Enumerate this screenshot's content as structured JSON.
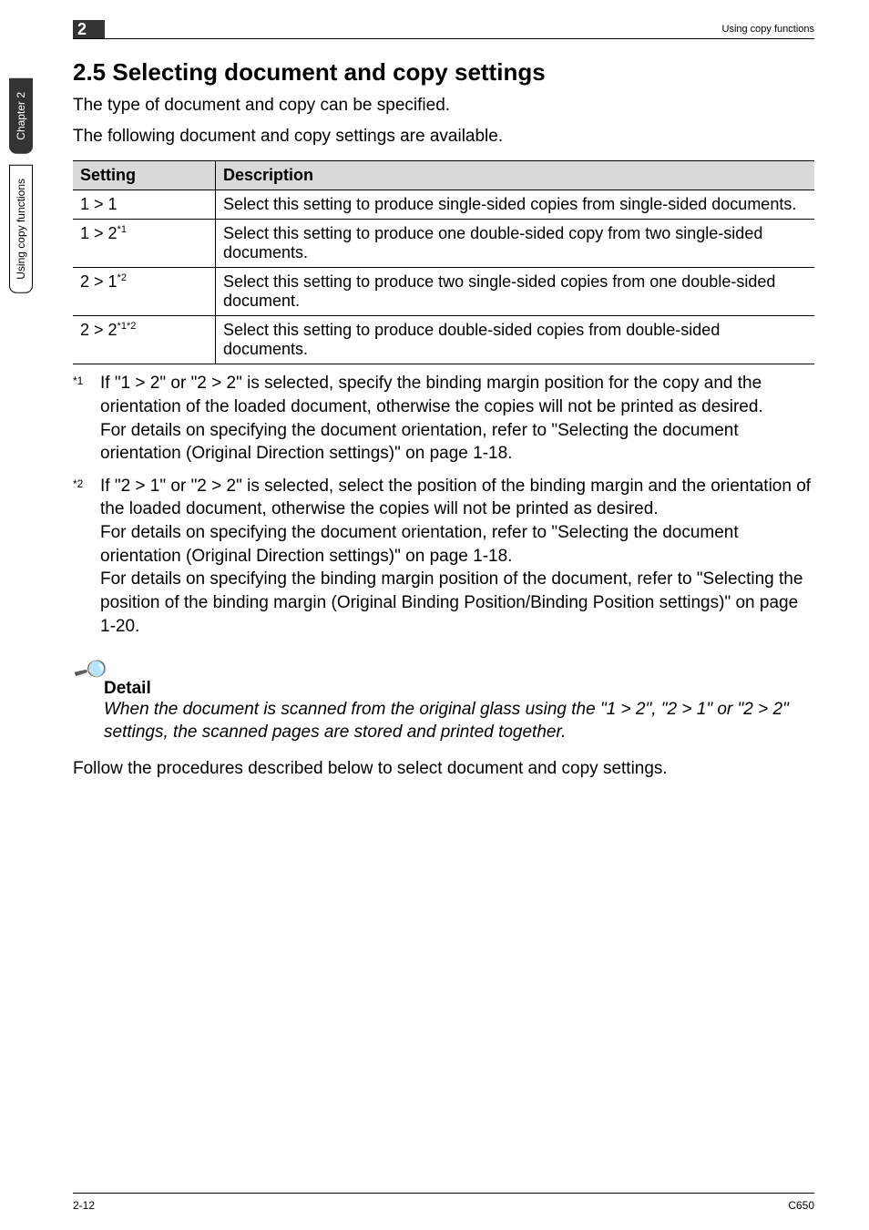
{
  "side": {
    "tab1": "Chapter 2",
    "tab2": "Using copy functions"
  },
  "header": {
    "chapnum": "2",
    "running": "Using copy functions"
  },
  "title": "2.5    Selecting document and copy settings",
  "intro1": "The type of document and copy can be specified.",
  "intro2": "The following document and copy settings are available.",
  "table": {
    "head_setting": "Setting",
    "head_desc": "Description",
    "rows": [
      {
        "s": "1 > 1",
        "sup": "",
        "d": "Select this setting to produce single-sided copies from single-sided documents."
      },
      {
        "s": "1 > 2",
        "sup": "*1",
        "d": "Select this setting to produce one double-sided copy from two single-sided documents."
      },
      {
        "s": "2 > 1",
        "sup": "*2",
        "d": "Select this setting to produce two single-sided copies from one double-sided document."
      },
      {
        "s": "2 > 2",
        "sup": "*1*2",
        "d": "Select this setting to produce double-sided copies from double-sided documents."
      }
    ]
  },
  "fn1_marker": "*1",
  "fn1_p1": "If \"1 > 2\" or \"2 > 2\" is selected, specify the binding margin position for the copy and the orientation of the loaded document, otherwise the copies will not be printed as desired.",
  "fn1_p2": "For details on specifying the document orientation, refer to \"Selecting the document orientation (Original Direction settings)\" on page 1-18.",
  "fn2_marker": "*2",
  "fn2_p1": "If \"2 > 1\" or \"2 > 2\" is selected, select the position of the binding margin and the orientation of the loaded document, otherwise the copies will not be printed as desired.",
  "fn2_p2": "For details on specifying the document orientation, refer to \"Selecting the document orientation (Original Direction settings)\" on page 1-18.",
  "fn2_p3": "For details on specifying the binding margin position of the document, refer to \"Selecting the position of the binding margin (Original Binding Position/Binding Position settings)\" on page 1-20.",
  "detail_heading": "Detail",
  "detail_body": "When the document is scanned from the original glass using the \"1 > 2\", \"2 > 1\" or \"2 > 2\" settings, the scanned pages are stored and printed together.",
  "closing": "Follow the procedures described below to select document and copy settings.",
  "footer": {
    "left": "2-12",
    "right": "C650"
  }
}
